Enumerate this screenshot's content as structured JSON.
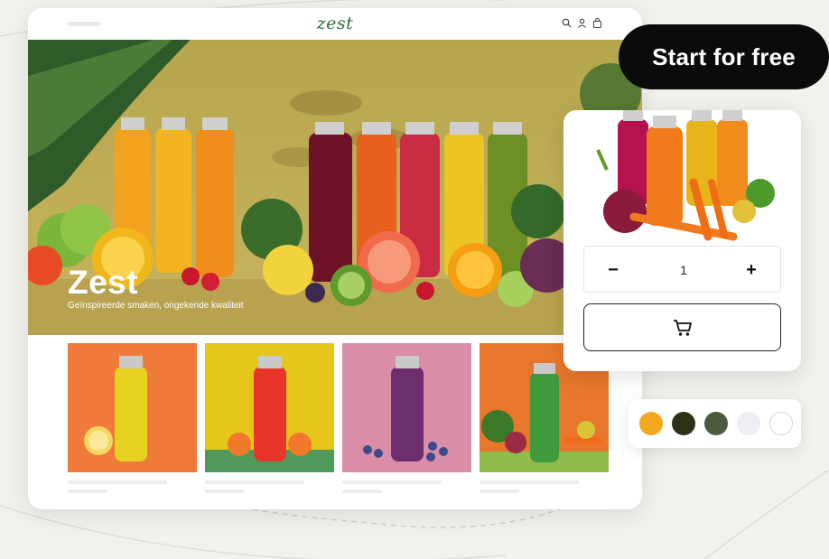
{
  "store": {
    "logo": "zest",
    "nav_icons": [
      "search-icon",
      "user-icon",
      "bag-icon"
    ],
    "hero": {
      "title": "Zest",
      "subtitle": "Geïnspireerde smaken, ongekende kwaliteit"
    },
    "products": [
      {
        "name": "yellow-juice",
        "background": "#f07a3a",
        "juice": "#e6d21e"
      },
      {
        "name": "red-juice",
        "background": "#e6c61a",
        "juice": "#e8352a"
      },
      {
        "name": "purple-juice",
        "background": "#d98da8",
        "juice": "#6b2f6d"
      },
      {
        "name": "green-juice",
        "background": "#e8772c",
        "juice": "#3f9a3c"
      }
    ]
  },
  "cta": {
    "label": "Start for free"
  },
  "product_card": {
    "quantity": "1",
    "minus_label": "−",
    "plus_label": "+",
    "cart_icon": "cart-icon"
  },
  "swatches": [
    {
      "color": "#f4a81d"
    },
    {
      "color": "#2c3317"
    },
    {
      "color": "#4b5b3b"
    },
    {
      "color": "#eceef4"
    },
    {
      "color": "#ffffff"
    }
  ],
  "colors": {
    "brand": "#2c6e3a",
    "cta_bg": "#0b0b0b",
    "page_bg": "#f1f1ee"
  }
}
